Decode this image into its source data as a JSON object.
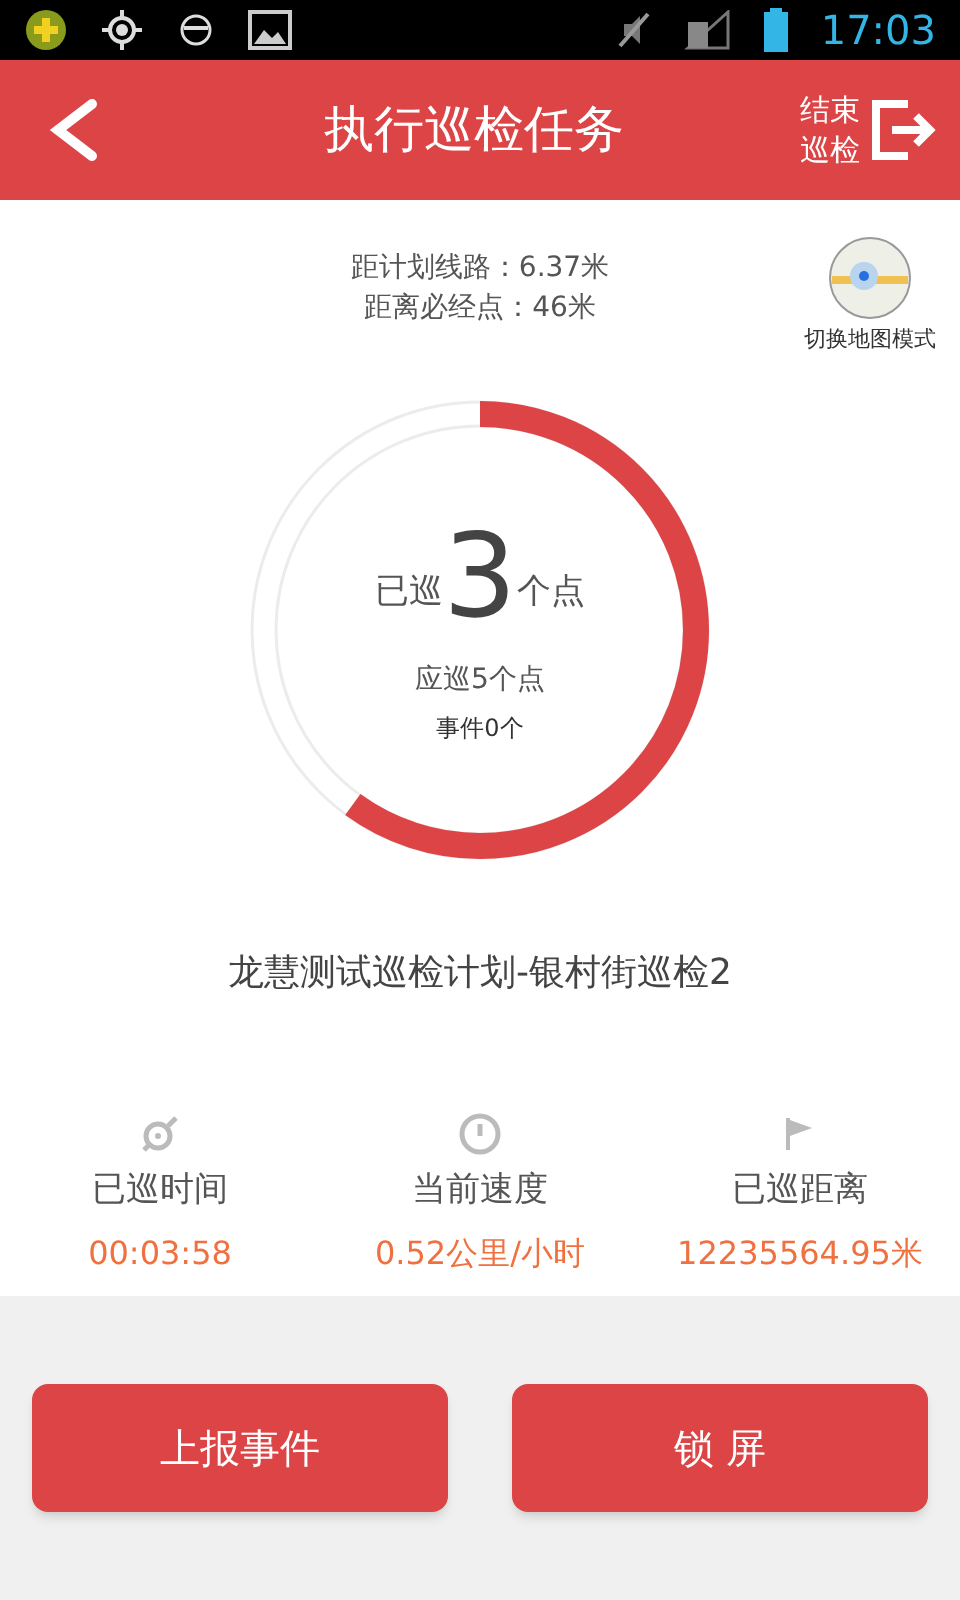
{
  "status_bar": {
    "time": "17:03"
  },
  "header": {
    "title": "执行巡检任务",
    "end_button": "结束巡检"
  },
  "info": {
    "lines": [
      "距计划线路：6.37米",
      "距离必经点：46米"
    ],
    "map_toggle": "切换地图模式"
  },
  "progress": {
    "prefix": "已巡",
    "count": "3",
    "suffix": "个点",
    "level": 0.6,
    "required": "应巡5个点",
    "events": "事件0个"
  },
  "plan_name": "龙慧测试巡检计划-银村街巡检2",
  "stats": [
    {
      "kind": "time",
      "label": "已巡时间",
      "value": "00:03:58"
    },
    {
      "kind": "speed",
      "label": "当前速度",
      "value": "0.52公里/小时"
    },
    {
      "kind": "distance",
      "label": "已巡距离",
      "value": "12235564.95米"
    }
  ],
  "buttons": [
    "上报事件",
    "锁 屏"
  ]
}
